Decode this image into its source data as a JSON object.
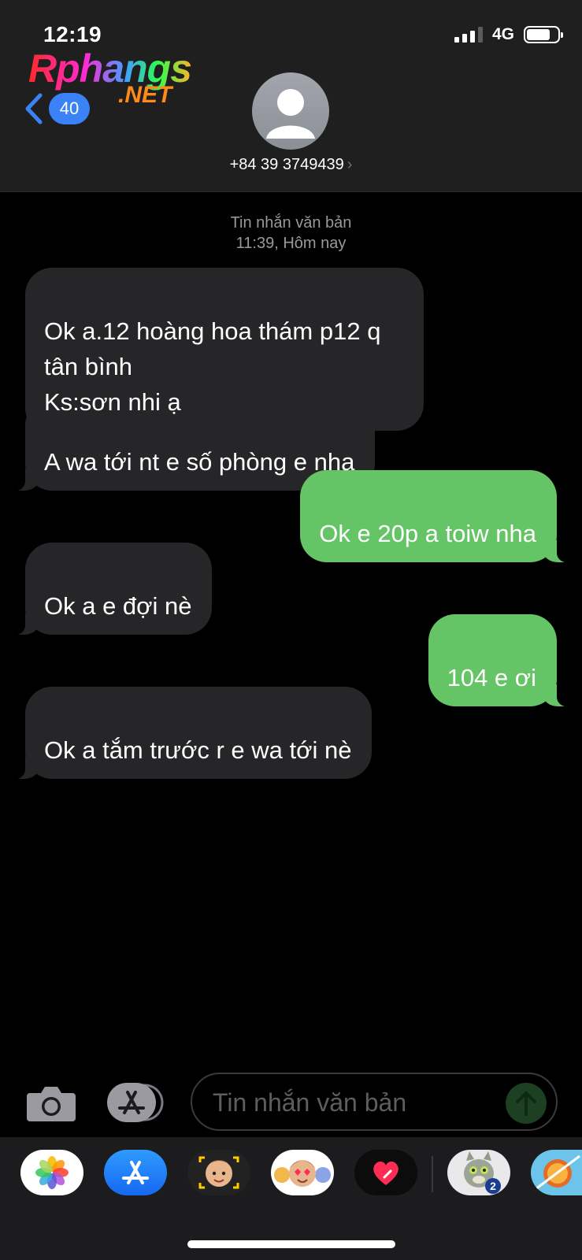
{
  "status_bar": {
    "time": "12:19",
    "network": "4G",
    "signal_bars": 3,
    "signal_total": 4,
    "battery_level": 0.75
  },
  "watermark": {
    "main": "Rphangs",
    "sub": ".NET"
  },
  "header": {
    "back_badge": "40",
    "contact": "+84 39 3749439",
    "contact_chevron": "›"
  },
  "conversation": {
    "service_label": "Tin nhắn văn bản",
    "timestamp": "11:39, Hôm nay",
    "messages": [
      {
        "direction": "incoming",
        "text": "Ok a.12 hoàng hoa thám p12 q\ntân bình\nKs:sơn nhi ạ"
      },
      {
        "direction": "incoming",
        "text": "A wa tới nt e số phòng e nha"
      },
      {
        "direction": "outgoing",
        "text": "Ok e 20p a toiw nha"
      },
      {
        "direction": "incoming",
        "text": "Ok a e đợi nè"
      },
      {
        "direction": "outgoing",
        "text": "104 e ơi"
      },
      {
        "direction": "incoming",
        "text": "Ok a tắm trước r e wa tới nè"
      }
    ]
  },
  "composer": {
    "placeholder": "Tin nhắn văn bản"
  },
  "app_drawer": {
    "apps": [
      "photos-icon",
      "app-store-icon",
      "memoji-camera-icon",
      "memoji-stickers-icon",
      "digital-touch-icon",
      "talking-tom-icon",
      "fruit-ninja-icon"
    ],
    "talking_tom_badge": "2"
  },
  "colors": {
    "incoming": "#262628",
    "outgoing": "#65c466",
    "badge": "#3b82f6",
    "header": "#1f1f1f"
  }
}
